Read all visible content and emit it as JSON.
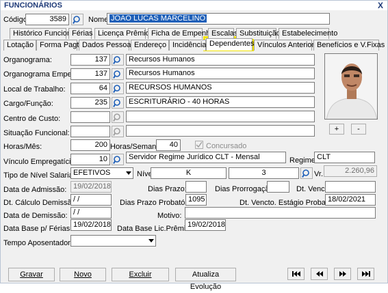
{
  "window": {
    "title": "FUNCIONÁRIOS",
    "close": "X"
  },
  "header": {
    "codigo_label": "Código:",
    "codigo_value": "3589",
    "nome_label": "Nome",
    "nome_value": "JOAO LUCAS MARCELINO"
  },
  "tabs_row1": [
    "Histórico Funcional",
    "Férias",
    "Licença Prêmio",
    "Ficha de Empenho",
    "Escalas",
    "Substituição",
    "Estabelecimento"
  ],
  "tabs_row2": [
    "Lotação",
    "Forma Pagto.",
    "Dados Pessoais",
    "Endereço",
    "Incidências",
    "Dependentes",
    "Vínculos Anteriores",
    "Benefícios e V.Fixas"
  ],
  "form": {
    "organograma_label": "Organograma:",
    "organograma_code": "137",
    "organograma_desc": "Recursos Humanos",
    "organograma_emp_label": "Organograma Empenho:",
    "organograma_emp_code": "137",
    "organograma_emp_desc": "Recursos Humanos",
    "local_label": "Local de Trabalho:",
    "local_code": "64",
    "local_desc": "RECURSOS HUMANOS",
    "cargo_label": "Cargo/Função:",
    "cargo_code": "235",
    "cargo_desc": "ESCRITURÁRIO - 40 HORAS",
    "centro_label": "Centro de Custo:",
    "situacao_label": "Situação Funcional:",
    "horas_mes_label": "Horas/Mês:",
    "horas_mes_value": "200",
    "horas_semana_label": "Horas/Semana:",
    "horas_semana_value": "40",
    "concursado_label": "Concursado",
    "vinculo_label": "Vínculo Empregatício:",
    "vinculo_code": "10",
    "vinculo_desc": "Servidor Regime Jurídico CLT - Mensal",
    "regime_label": "Regime:",
    "regime_value": "CLT",
    "tipo_nivel_label": "Tipo de Nível Salarial:",
    "tipo_nivel_value": "EFETIVOS",
    "nivel_label": "Nível",
    "nivel_value": "K",
    "nivel_num": "3",
    "vr_label": "Vr.",
    "vr_value": "2.260,96",
    "admissao_label": "Data de Admissão:",
    "admissao_value": "19/02/2018",
    "dias_prazo_label": "Dias Prazo:",
    "dias_prorrog_label": "Dias Prorrogação:",
    "dt_venc_label": "Dt. Venc.:",
    "dt_calc_label": "Dt. Cálculo Demissão:",
    "dt_calc_value": " / /",
    "dias_prob_label": "Dias Prazo Probatório:",
    "dias_prob_value": "1095",
    "dt_estagio_label": "Dt. Vencto. Estágio Probatório:",
    "dt_estagio_value": "18/02/2021",
    "demissao_label": "Data de Demissão:",
    "demissao_value": " / /",
    "motivo_label": "Motivo:",
    "base_ferias_label": "Data Base p/ Férias:",
    "base_ferias_value": "19/02/2018",
    "base_lic_label": "Data Base Lic.Prêmio :",
    "base_lic_value": "19/02/2018",
    "tempo_apos_label": "Tempo Aposentadoria:"
  },
  "photo_buttons": {
    "plus": "+",
    "minus": "-"
  },
  "buttons": {
    "gravar": "Gravar",
    "novo": "Novo",
    "excluir": "Excluir",
    "atualiza": "Atualiza Evolução"
  },
  "colors": {
    "title": "#1e3a78",
    "highlight": "#f4e400",
    "selection": "#1e5fb8"
  }
}
